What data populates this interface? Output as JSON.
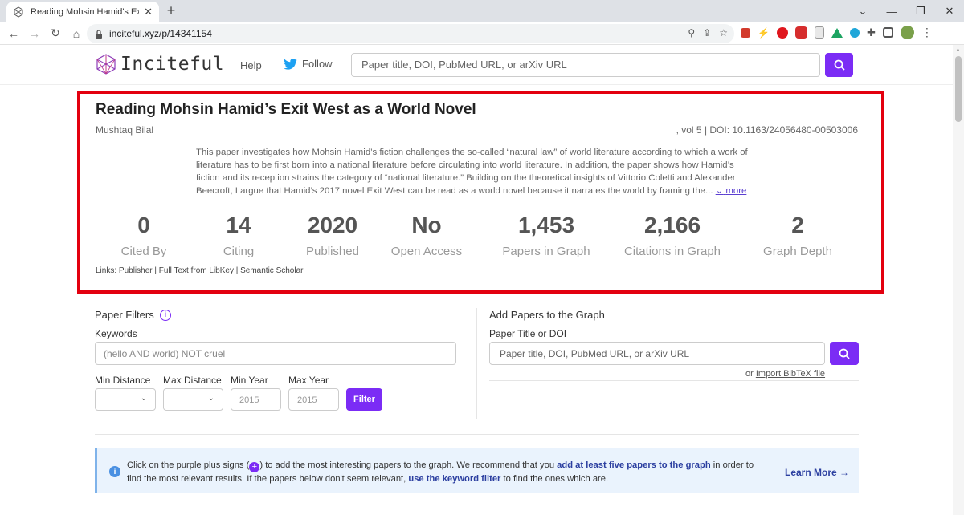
{
  "browser": {
    "tab_title": "Reading Mohsin Hamid's Exit We",
    "url": "inciteful.xyz/p/14341154"
  },
  "header": {
    "logo": "Inciteful",
    "help": "Help",
    "follow": "Follow",
    "search_placeholder": "Paper title, DOI, PubMed URL, or arXiv URL"
  },
  "paper": {
    "title": "Reading Mohsin Hamid’s Exit West as a World Novel",
    "author": "Mushtaq Bilal",
    "meta": ", vol 5  |  DOI: 10.1163/24056480-00503006",
    "abstract": "This paper investigates how Mohsin Hamid’s fiction challenges the so-called “natural law” of world literature according to which a work of literature has to be first born into a national literature before circulating into world literature. In addition, the paper shows how Hamid’s fiction and its reception strains the category of “national literature.” Building on the theoretical insights of Vittorio Coletti and Alexander Beecroft, I argue that Hamid’s 2017 novel Exit West can be read as a world novel because it narrates the world by framing the...",
    "more": "more",
    "stats": [
      {
        "value": "0",
        "label": "Cited By"
      },
      {
        "value": "14",
        "label": "Citing"
      },
      {
        "value": "2020",
        "label": "Published"
      },
      {
        "value": "No",
        "label": "Open Access"
      },
      {
        "value": "1,453",
        "label": "Papers in Graph"
      },
      {
        "value": "2,166",
        "label": "Citations in Graph"
      },
      {
        "value": "2",
        "label": "Graph Depth"
      }
    ],
    "links_label": "Links:",
    "links": [
      "Publisher",
      "Full Text from LibKey",
      "Semantic Scholar"
    ]
  },
  "filters": {
    "title": "Paper Filters",
    "keywords_label": "Keywords",
    "keywords_placeholder": "(hello AND world) NOT cruel",
    "min_distance": "Min Distance",
    "max_distance": "Max Distance",
    "min_year": "Min Year",
    "max_year": "Max Year",
    "min_year_placeholder": "2015",
    "max_year_placeholder": "2015",
    "button": "Filter"
  },
  "add_papers": {
    "title": "Add Papers to the Graph",
    "field_label": "Paper Title or DOI",
    "placeholder": "Paper title, DOI, PubMed URL, or arXiv URL",
    "import_prefix": "or ",
    "import_link": "Import BibTeX file"
  },
  "banner": {
    "t1": "Click on the purple plus signs (",
    "t2": ") to add the most interesting papers to the graph. We recommend that you ",
    "b1": "add at least five papers to the graph",
    "t3": " in order to find the most relevant results. If the papers below don't seem relevant, ",
    "b2": "use the keyword filter",
    "t4": " to find the ones which are.",
    "learn_more": "Learn More →"
  },
  "colors": {
    "accent": "#7b2cf5",
    "highlight_border": "#e3000f",
    "banner_bg": "#eaf3fd",
    "banner_link": "#2c3fa0"
  }
}
